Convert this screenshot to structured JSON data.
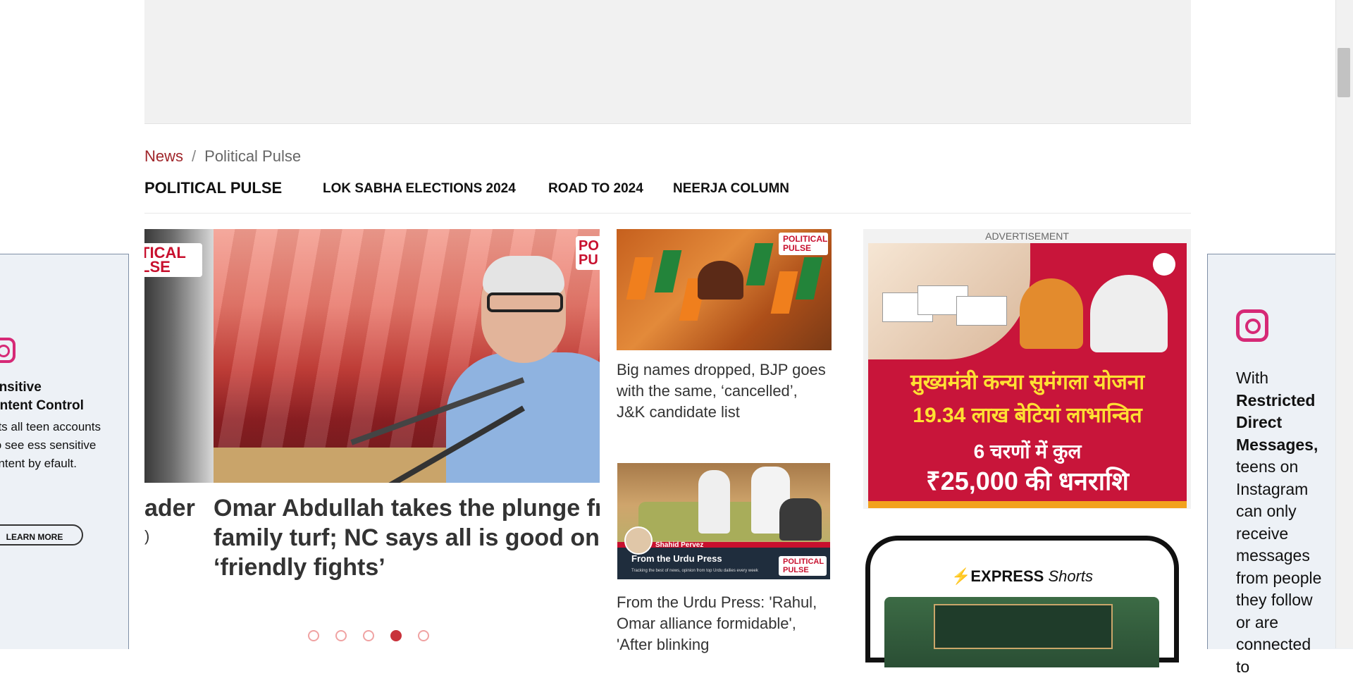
{
  "breadcrumb": {
    "home": "News",
    "separator": "/",
    "current": "Political Pulse"
  },
  "section_nav": {
    "title": "POLITICAL PULSE",
    "links": [
      "LOK SABHA ELECTIONS 2024",
      "ROAD TO 2024",
      "NEERJA COLUMN"
    ]
  },
  "carousel": {
    "prev_slide": {
      "title_fragment": "ader",
      "sub_fragment": ")",
      "watermark": "TICAL LSE"
    },
    "main_slide": {
      "title_line1": "Omar Abdullah takes the plunge fr",
      "title_line2": "family turf; NC says all is good on",
      "title_line3": "‘friendly fights’",
      "watermark": "PO PU"
    },
    "dots": {
      "count": 5,
      "active_index": 3
    }
  },
  "stories": [
    {
      "title": "Big names dropped, BJP goes with the same, ‘cancelled’, J&K candidate list",
      "watermark": "POLITICAL PULSE"
    },
    {
      "title": "From the Urdu Press: 'Rahul, Omar alliance formidable', 'After blinking",
      "image_name": "Shahid Pervez",
      "image_title": "From the Urdu Press",
      "image_sub": "Tracking the best of news, opinion from top Urdu dailies every week",
      "watermark": "POLITICAL PULSE"
    }
  ],
  "ad": {
    "label": "ADVERTISEMENT",
    "line1": "मुख्यमंत्री कन्या सुमंगला योजना",
    "line2": "19.34 लाख बेटियां लाभान्वित",
    "line3": "6 चरणों में कुल",
    "line4": "₹25,000 की धनराशि"
  },
  "express_shorts": {
    "brand": "EXPRESS",
    "brand_italic": "Shorts",
    "icon": "bolt-icon"
  },
  "left_side_ad": {
    "icon": "instagram-icon",
    "title_line1": "ensitive",
    "title_line2": "ontent Control",
    "body": "ets all teen accounts to see ess sensitive ontent by efault.",
    "button": "LEARN MORE"
  },
  "right_side_ad": {
    "icon": "instagram-icon",
    "intro": "With",
    "bold": "Restricted Direct Messages,",
    "body": "teens on Instagram can only receive messages from people they follow or are connected to"
  },
  "colors": {
    "accent_red": "#a0262b",
    "dot_active": "#c8323b",
    "ad_background": "#c8153a",
    "instagram": "#d62976"
  }
}
